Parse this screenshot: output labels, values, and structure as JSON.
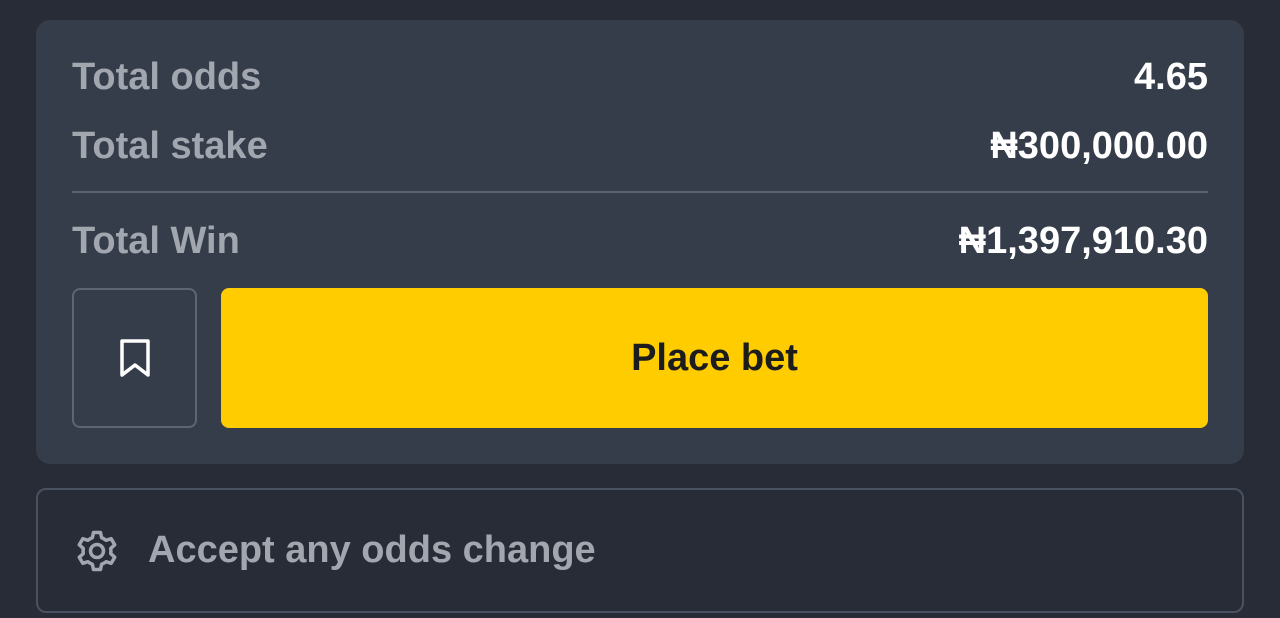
{
  "summary": {
    "total_odds_label": "Total odds",
    "total_odds_value": "4.65",
    "total_stake_label": "Total stake",
    "total_stake_value": "₦300,000.00",
    "total_win_label": "Total Win",
    "total_win_value": "₦1,397,910.30"
  },
  "actions": {
    "bookmark_icon": "bookmark-icon",
    "place_bet_label": "Place bet"
  },
  "settings": {
    "icon": "gear-icon",
    "accept_odds_label": "Accept any odds change"
  },
  "colors": {
    "background": "#272c36",
    "card": "#353d4a",
    "accent": "#ffcc00",
    "label_text": "#a1a6af",
    "value_text": "#ffffff"
  }
}
